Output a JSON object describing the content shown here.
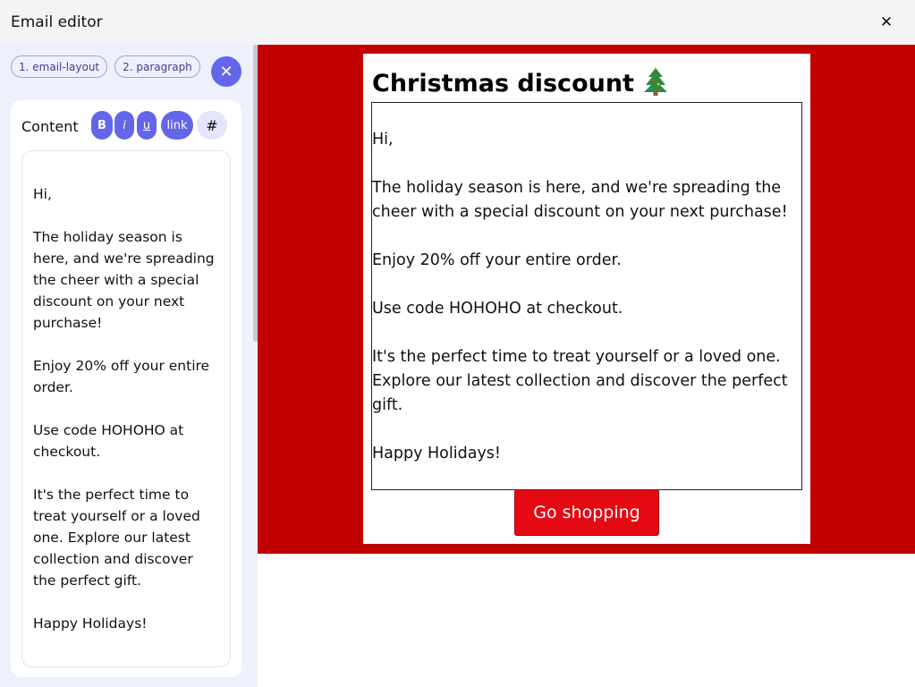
{
  "window": {
    "title": "Email editor"
  },
  "breadcrumbs": [
    "1. email-layout",
    "2. paragraph"
  ],
  "content_panel": {
    "label": "Content",
    "format_buttons": {
      "bold": "B",
      "italic": "i",
      "underline": "u",
      "link": "link",
      "hash": "#"
    },
    "paragraphs": [
      "Hi,",
      "The holiday season is here, and we're spreading the cheer with a special discount on your next purchase!",
      "Enjoy 20% off your entire order.",
      "Use code HOHOHO at checkout.",
      "It's the perfect time to treat yourself or a loved one. Explore our latest collection and discover the perfect gift.",
      "Happy Holidays!"
    ]
  },
  "email_preview": {
    "heading": "Christmas discount",
    "heading_icon": "christmas-tree-icon",
    "cta_label": "Go shopping",
    "background_color": "#c20000",
    "button_color": "#e50914"
  },
  "colors": {
    "accent": "#6366e8",
    "sidebar_bg": "#eef1fd"
  }
}
